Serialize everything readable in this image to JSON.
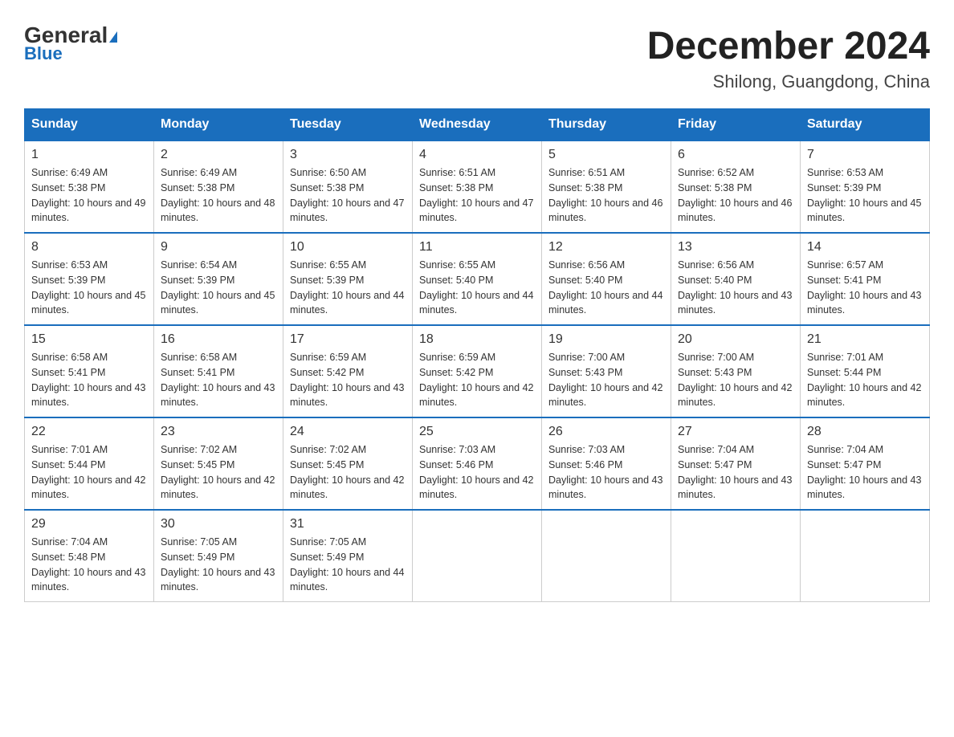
{
  "header": {
    "logo_general": "General",
    "logo_blue": "Blue",
    "month_year": "December 2024",
    "location": "Shilong, Guangdong, China"
  },
  "days_of_week": [
    "Sunday",
    "Monday",
    "Tuesday",
    "Wednesday",
    "Thursday",
    "Friday",
    "Saturday"
  ],
  "weeks": [
    [
      {
        "day": "1",
        "sunrise": "6:49 AM",
        "sunset": "5:38 PM",
        "daylight": "10 hours and 49 minutes."
      },
      {
        "day": "2",
        "sunrise": "6:49 AM",
        "sunset": "5:38 PM",
        "daylight": "10 hours and 48 minutes."
      },
      {
        "day": "3",
        "sunrise": "6:50 AM",
        "sunset": "5:38 PM",
        "daylight": "10 hours and 47 minutes."
      },
      {
        "day": "4",
        "sunrise": "6:51 AM",
        "sunset": "5:38 PM",
        "daylight": "10 hours and 47 minutes."
      },
      {
        "day": "5",
        "sunrise": "6:51 AM",
        "sunset": "5:38 PM",
        "daylight": "10 hours and 46 minutes."
      },
      {
        "day": "6",
        "sunrise": "6:52 AM",
        "sunset": "5:38 PM",
        "daylight": "10 hours and 46 minutes."
      },
      {
        "day": "7",
        "sunrise": "6:53 AM",
        "sunset": "5:39 PM",
        "daylight": "10 hours and 45 minutes."
      }
    ],
    [
      {
        "day": "8",
        "sunrise": "6:53 AM",
        "sunset": "5:39 PM",
        "daylight": "10 hours and 45 minutes."
      },
      {
        "day": "9",
        "sunrise": "6:54 AM",
        "sunset": "5:39 PM",
        "daylight": "10 hours and 45 minutes."
      },
      {
        "day": "10",
        "sunrise": "6:55 AM",
        "sunset": "5:39 PM",
        "daylight": "10 hours and 44 minutes."
      },
      {
        "day": "11",
        "sunrise": "6:55 AM",
        "sunset": "5:40 PM",
        "daylight": "10 hours and 44 minutes."
      },
      {
        "day": "12",
        "sunrise": "6:56 AM",
        "sunset": "5:40 PM",
        "daylight": "10 hours and 44 minutes."
      },
      {
        "day": "13",
        "sunrise": "6:56 AM",
        "sunset": "5:40 PM",
        "daylight": "10 hours and 43 minutes."
      },
      {
        "day": "14",
        "sunrise": "6:57 AM",
        "sunset": "5:41 PM",
        "daylight": "10 hours and 43 minutes."
      }
    ],
    [
      {
        "day": "15",
        "sunrise": "6:58 AM",
        "sunset": "5:41 PM",
        "daylight": "10 hours and 43 minutes."
      },
      {
        "day": "16",
        "sunrise": "6:58 AM",
        "sunset": "5:41 PM",
        "daylight": "10 hours and 43 minutes."
      },
      {
        "day": "17",
        "sunrise": "6:59 AM",
        "sunset": "5:42 PM",
        "daylight": "10 hours and 43 minutes."
      },
      {
        "day": "18",
        "sunrise": "6:59 AM",
        "sunset": "5:42 PM",
        "daylight": "10 hours and 42 minutes."
      },
      {
        "day": "19",
        "sunrise": "7:00 AM",
        "sunset": "5:43 PM",
        "daylight": "10 hours and 42 minutes."
      },
      {
        "day": "20",
        "sunrise": "7:00 AM",
        "sunset": "5:43 PM",
        "daylight": "10 hours and 42 minutes."
      },
      {
        "day": "21",
        "sunrise": "7:01 AM",
        "sunset": "5:44 PM",
        "daylight": "10 hours and 42 minutes."
      }
    ],
    [
      {
        "day": "22",
        "sunrise": "7:01 AM",
        "sunset": "5:44 PM",
        "daylight": "10 hours and 42 minutes."
      },
      {
        "day": "23",
        "sunrise": "7:02 AM",
        "sunset": "5:45 PM",
        "daylight": "10 hours and 42 minutes."
      },
      {
        "day": "24",
        "sunrise": "7:02 AM",
        "sunset": "5:45 PM",
        "daylight": "10 hours and 42 minutes."
      },
      {
        "day": "25",
        "sunrise": "7:03 AM",
        "sunset": "5:46 PM",
        "daylight": "10 hours and 42 minutes."
      },
      {
        "day": "26",
        "sunrise": "7:03 AM",
        "sunset": "5:46 PM",
        "daylight": "10 hours and 43 minutes."
      },
      {
        "day": "27",
        "sunrise": "7:04 AM",
        "sunset": "5:47 PM",
        "daylight": "10 hours and 43 minutes."
      },
      {
        "day": "28",
        "sunrise": "7:04 AM",
        "sunset": "5:47 PM",
        "daylight": "10 hours and 43 minutes."
      }
    ],
    [
      {
        "day": "29",
        "sunrise": "7:04 AM",
        "sunset": "5:48 PM",
        "daylight": "10 hours and 43 minutes."
      },
      {
        "day": "30",
        "sunrise": "7:05 AM",
        "sunset": "5:49 PM",
        "daylight": "10 hours and 43 minutes."
      },
      {
        "day": "31",
        "sunrise": "7:05 AM",
        "sunset": "5:49 PM",
        "daylight": "10 hours and 44 minutes."
      },
      null,
      null,
      null,
      null
    ]
  ]
}
